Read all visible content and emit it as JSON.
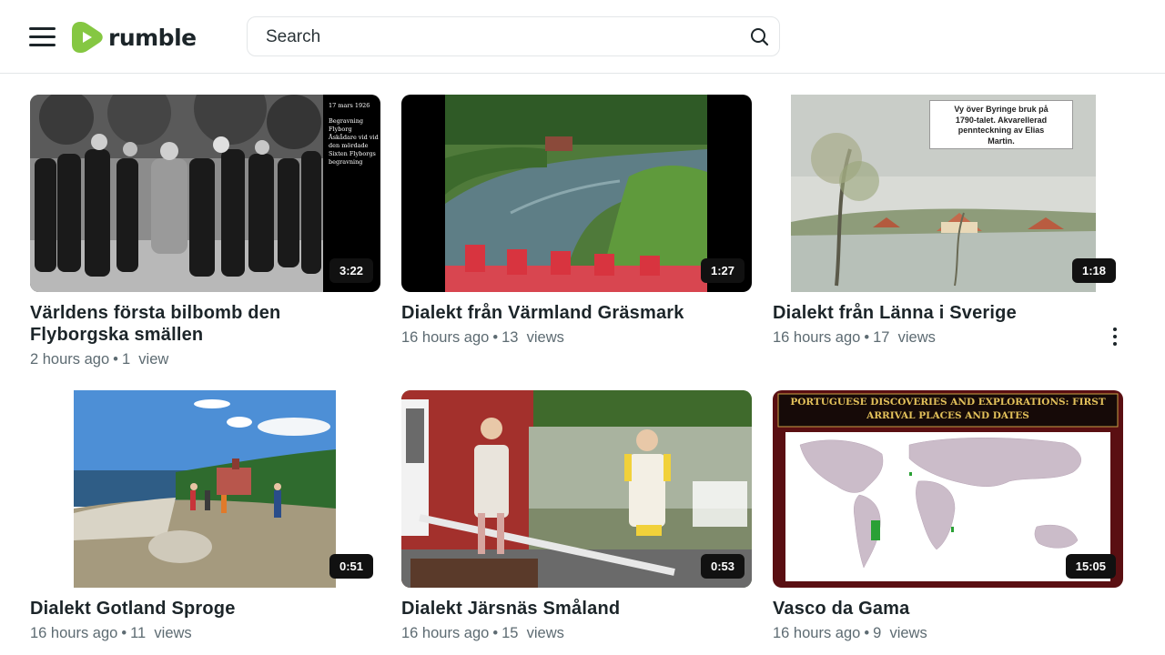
{
  "header": {
    "logo_text": "rumble",
    "search_placeholder": "Search",
    "brand_color": "#85c742"
  },
  "videos": [
    {
      "title": "Världens första bilbomb den Flyborgska smällen",
      "time": "2 hours ago",
      "views_count": "1",
      "views_label": "view",
      "duration": "3:22",
      "thumb_caption": "17 mars 1926",
      "thumb_note": [
        "Begravning",
        "Flyborg",
        "Åskådare vid vid",
        "den mördade",
        "Sixten Flyborgs",
        "begravning"
      ]
    },
    {
      "title": "Dialekt från Värmland Gräsmark",
      "time": "16 hours ago",
      "views_count": "13",
      "views_label": "views",
      "duration": "1:27"
    },
    {
      "title": "Dialekt från Länna i Sverige",
      "time": "16 hours ago",
      "views_count": "17",
      "views_label": "views",
      "duration": "1:18",
      "thumb_note": [
        "Vy över Byringe bruk på",
        "1790-talet. Akvarellerad",
        "pennteckning av Elias",
        "Martin."
      ]
    },
    {
      "title": "Dialekt Gotland Sproge",
      "time": "16 hours ago",
      "views_count": "11",
      "views_label": "views",
      "duration": "0:51"
    },
    {
      "title": "Dialekt Järsnäs Småland",
      "time": "16 hours ago",
      "views_count": "15",
      "views_label": "views",
      "duration": "0:53"
    },
    {
      "title": "Vasco da Gama",
      "time": "16 hours ago",
      "views_count": "9",
      "views_label": "views",
      "duration": "15:05",
      "thumb_note": [
        "PORTUGUESE DISCOVERIES AND EXPLORATIONS: FIRST",
        "ARRIVAL PLACES AND DATES"
      ]
    }
  ]
}
